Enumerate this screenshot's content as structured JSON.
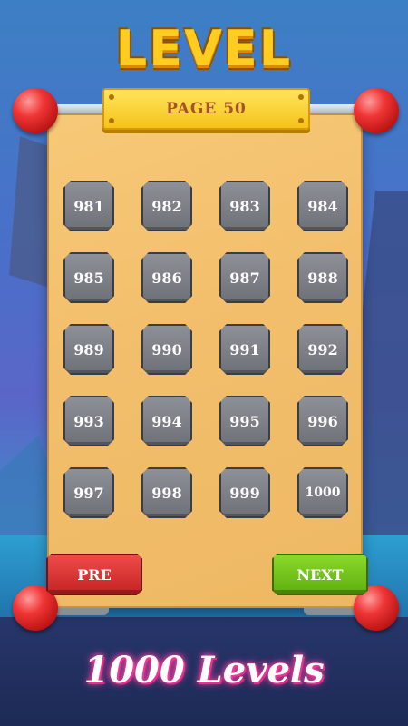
{
  "title": "LEVEL",
  "page_label": "PAGE 50",
  "levels": [
    "981",
    "982",
    "983",
    "984",
    "985",
    "986",
    "987",
    "988",
    "989",
    "990",
    "991",
    "992",
    "993",
    "994",
    "995",
    "996",
    "997",
    "998",
    "999",
    "1000"
  ],
  "buttons": {
    "pre": "PRE",
    "next": "NEXT"
  },
  "footer": "1000 Levels",
  "colors": {
    "title": "#ffcc1f",
    "pre": "#e03a3a",
    "next": "#76c41d",
    "tile": "#7d8087",
    "panel": "#f3bf6c"
  }
}
